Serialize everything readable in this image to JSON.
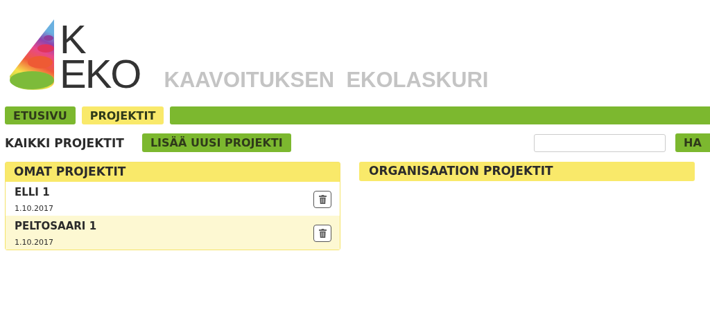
{
  "logo": {
    "line_1": "K",
    "line_2": "EKO"
  },
  "app_title": "KAAVOITUKSEN  EKOLASKURI",
  "tabs": [
    {
      "label": "ETUSIVU",
      "selected": false
    },
    {
      "label": "PROJEKTIT",
      "selected": true
    }
  ],
  "toolbar": {
    "heading": "KAIKKI PROJEKTIT",
    "add_button": "LISÄÄ UUSI PROJEKTI",
    "search_button": "HA"
  },
  "own_projects": {
    "title": "OMAT PROJEKTIT",
    "rows": [
      {
        "name": "ELLI 1",
        "date": "1.10.2017"
      },
      {
        "name": "PELTOSAARI 1",
        "date": "1.10.2017"
      }
    ]
  },
  "organisation_projects": {
    "title": "ORGANISAATION PROJEKTIT"
  }
}
